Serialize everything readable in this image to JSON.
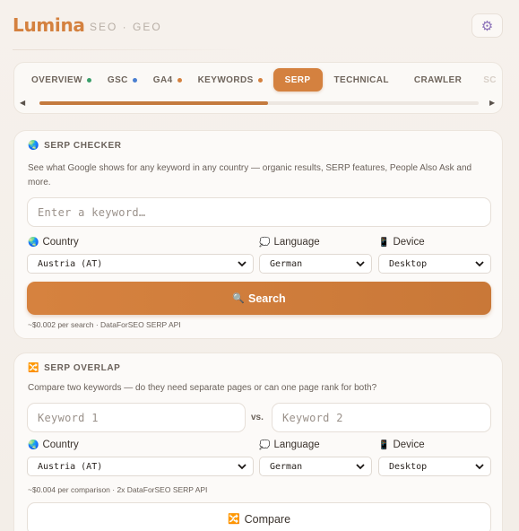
{
  "header": {
    "brand": "Lumina",
    "subtitle": "SEO · GEO",
    "settings_icon": "gear-icon"
  },
  "tabs": [
    {
      "label": "OVERVIEW",
      "dot": "#3a9f6a"
    },
    {
      "label": "GSC",
      "dot": "#4a7fd0"
    },
    {
      "label": "GA4",
      "dot": "#d4813f"
    },
    {
      "label": "KEYWORDS",
      "dot": "#d4813f"
    },
    {
      "label": "SERP",
      "active": true
    },
    {
      "label": "TECHNICAL"
    },
    {
      "label": "CRAWLER"
    },
    {
      "label": "SC"
    }
  ],
  "tab_scroll": {
    "position": 0.52
  },
  "serp_checker": {
    "title": "SERP CHECKER",
    "title_icon": "globe-icon",
    "description": "See what Google shows for any keyword in any country — organic results, SERP features, People Also Ask and more.",
    "keyword_placeholder": "Enter a keyword…",
    "country_label": "Country",
    "country_value": "Austria (AT)",
    "language_label": "Language",
    "language_value": "German",
    "device_label": "Device",
    "device_value": "Desktop",
    "search_button": "Search",
    "footnote": "~$0.002 per search · DataForSEO SERP API"
  },
  "serp_overlap": {
    "title": "SERP OVERLAP",
    "title_icon": "shuffle-icon",
    "description": "Compare two keywords — do they need separate pages or can one page rank for both?",
    "keyword1_placeholder": "Keyword 1",
    "vs_label": "vs.",
    "keyword2_placeholder": "Keyword 2",
    "country_label": "Country",
    "country_value": "Austria (AT)",
    "language_label": "Language",
    "language_value": "German",
    "device_label": "Device",
    "device_value": "Desktop",
    "footnote": "~$0.004 per comparison · 2x DataForSEO SERP API",
    "compare_button": "Compare"
  }
}
